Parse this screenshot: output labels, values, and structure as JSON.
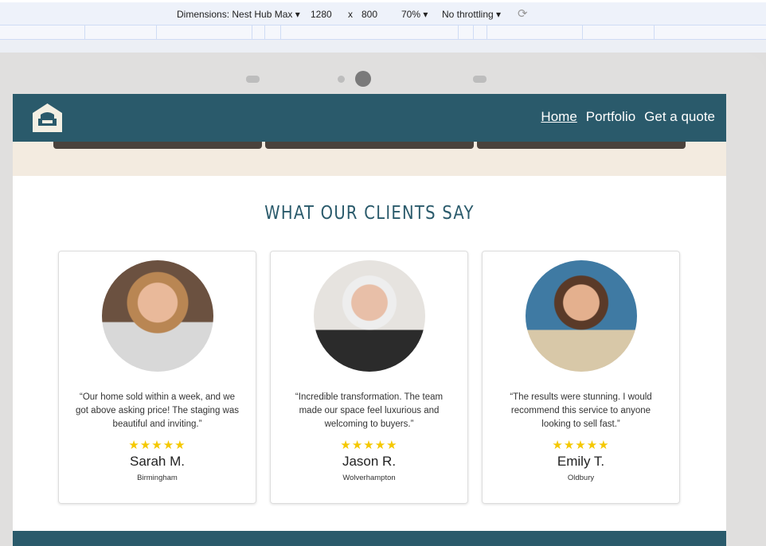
{
  "devtools": {
    "dimensions": "Dimensions: Nest Hub Max ▾",
    "width": "1280",
    "x": "x",
    "height": "800",
    "zoom": "70% ▾",
    "throttling": "No throttling ▾",
    "rotate_icon": "rotate-icon"
  },
  "nav": {
    "links": [
      "Home",
      "Portfolio",
      "Get a quote"
    ],
    "active": "Home"
  },
  "section": {
    "title": "WHAT OUR CLIENTS SAY"
  },
  "testimonials": [
    {
      "quote": "“Our home sold within a week, and we got above asking price! The staging was beautiful and inviting.”",
      "stars": "★★★★★",
      "name": "Sarah M.",
      "city": "Birmingham"
    },
    {
      "quote": "“Incredible transformation. The team made our space feel luxurious and welcoming to buyers.”",
      "stars": "★★★★★",
      "name": "Jason R.",
      "city": "Wolverhampton"
    },
    {
      "quote": "“The results were stunning. I would recommend this service to anyone looking to sell fast.”",
      "stars": "★★★★★",
      "name": "Emily T.",
      "city": "Oldbury"
    }
  ],
  "colors": {
    "brand": "#2a5a6b",
    "star": "#f5c800",
    "beige": "#f3ebe0"
  }
}
